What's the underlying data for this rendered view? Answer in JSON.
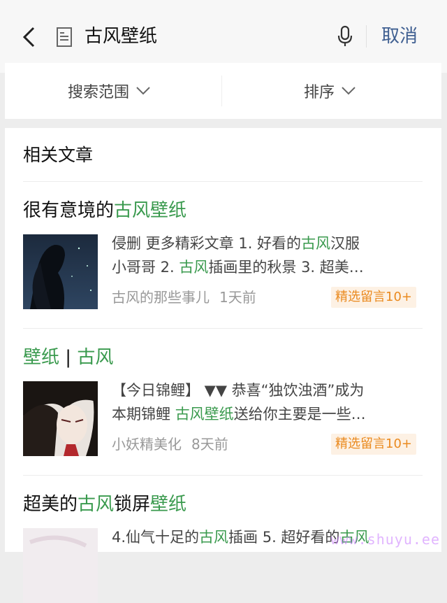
{
  "header": {
    "query": "古风壁纸",
    "cancel_label": "取消"
  },
  "filters": {
    "scope_label": "搜索范围",
    "sort_label": "排序"
  },
  "results": {
    "section_title": "相关文章",
    "articles": [
      {
        "title_parts": [
          "很有意境的",
          "古风壁纸"
        ],
        "excerpt_line1": [
          "侵删 更多精彩文章 1. 好看的",
          "古风",
          "汉服"
        ],
        "excerpt_line2": [
          "小哥哥 2. ",
          "古风",
          "插画里的秋景 3. 超美…"
        ],
        "source": "古风的那些事儿",
        "time": "1天前",
        "badge": "精选留言10+"
      },
      {
        "title_parts": [
          "壁纸",
          " | ",
          "古风"
        ],
        "excerpt_line1": [
          "【今日锦鲤】 ▼▼ 恭喜“独饮浊酒”成为"
        ],
        "excerpt_line2": [
          "本期锦鲤 ",
          "古风壁纸",
          "送给你主要是一些…"
        ],
        "source": "小妖精美化",
        "time": "8天前",
        "badge": "精选留言10+"
      },
      {
        "title_parts": [
          "超美的",
          "古风",
          "锁屏",
          "壁纸"
        ],
        "excerpt_line1": [
          "4.仙气十足的",
          "古风",
          "插画 5. 超好看的",
          "古风"
        ]
      }
    ]
  },
  "watermark": "www.shuyu.ee",
  "colors": {
    "highlight": "#3a9a4e",
    "cancel": "#3f5f91",
    "badge_text": "#ea8a1f",
    "badge_bg": "#fdf1e4"
  }
}
